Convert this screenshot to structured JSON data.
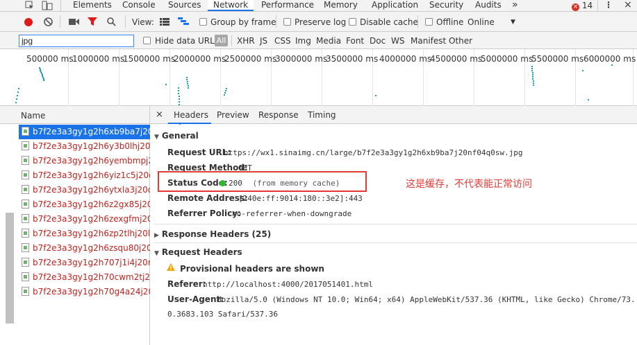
{
  "devtools": {
    "tabs": [
      "Elements",
      "Console",
      "Sources",
      "Network",
      "Performance",
      "Memory",
      "Application",
      "Security",
      "Audits"
    ],
    "more_tabs": "»",
    "error_count": "14",
    "menu": "⋮",
    "close": "×"
  },
  "toolbar": {
    "view_label": "View:",
    "group_by_frame": "Group by frame",
    "preserve_log": "Preserve log",
    "disable_cache": "Disable cache",
    "offline": "Offline",
    "throttle": "Online"
  },
  "filter": {
    "value": "jpg",
    "hide_data_urls": "Hide data URLs",
    "all": "All",
    "types": [
      "XHR",
      "JS",
      "CSS",
      "Img",
      "Media",
      "Font",
      "Doc",
      "WS",
      "Manifest",
      "Other"
    ]
  },
  "overview": {
    "ticks": [
      "500000 ms",
      "1000000 ms",
      "1500000 ms",
      "2000000 ms",
      "2500000 ms",
      "3000000 ms",
      "3500000 ms",
      "4000000 ms",
      "4500000 ms",
      "5000000 ms",
      "5500000 ms",
      "6000000 ms"
    ]
  },
  "list": {
    "header": "Name",
    "rows": [
      "b7f2e3a3gy1g2h6xb9ba7j20...",
      "b7f2e3a3gy1g2h6y3b0lhj20d...",
      "b7f2e3a3gy1g2h6yembmpj2...",
      "b7f2e3a3gy1g2h6yiz1c5j20d...",
      "b7f2e3a3gy1g2h6ytxla3j20dj...",
      "b7f2e3a3gy1g2h6z2gx85j20f...",
      "b7f2e3a3gy1g2h6zexgfmj20...",
      "b7f2e3a3gy1g2h6zp2tlhj20l9...",
      "b7f2e3a3gy1g2h6zsqu80j20...",
      "b7f2e3a3gy1g2h707j1i4j20rg...",
      "b7f2e3a3gy1g2h70cwm2tj20...",
      "b7f2e3a3gy1g2h70g4a24j20..."
    ]
  },
  "detail": {
    "close": "×",
    "tabs": [
      "Headers",
      "Preview",
      "Response",
      "Timing"
    ],
    "general": {
      "title": "General",
      "request_url_key": "Request URL:",
      "request_url": "https://wx1.sinaimg.cn/large/b7f2e3a3gy1g2h6xb9ba7j20nf04q0sw.jpg",
      "request_method_key": "Request Method:",
      "request_method": "GET",
      "status_code_key": "Status Code:",
      "status_code": "200",
      "status_note": "(from memory cache)",
      "remote_address_key": "Remote Address:",
      "remote_address": "[240e:ff:9014:180::3e2]:443",
      "referrer_policy_key": "Referrer Policy:",
      "referrer_policy": "no-referrer-when-downgrade"
    },
    "response_headers": "Response Headers (25)",
    "request_headers": {
      "title": "Request Headers",
      "warning": "Provisional headers are shown",
      "referer_key": "Referer:",
      "referer": "http://localhost:4000/2017051401.html",
      "ua_key": "User-Agent:",
      "ua_line1": "Mozilla/5.0 (Windows NT 10.0; Win64; x64) AppleWebKit/537.36 (KHTML, like Gecko) Chrome/73.",
      "ua_line2": "0.3683.103 Safari/537.36"
    }
  },
  "annotation": "这是缓存，不代表能正常访问",
  "colors": {
    "accent": "#1a73e8",
    "error_red": "#c0221d",
    "annotation_red": "#e53935",
    "status_green": "#2eb82e"
  }
}
